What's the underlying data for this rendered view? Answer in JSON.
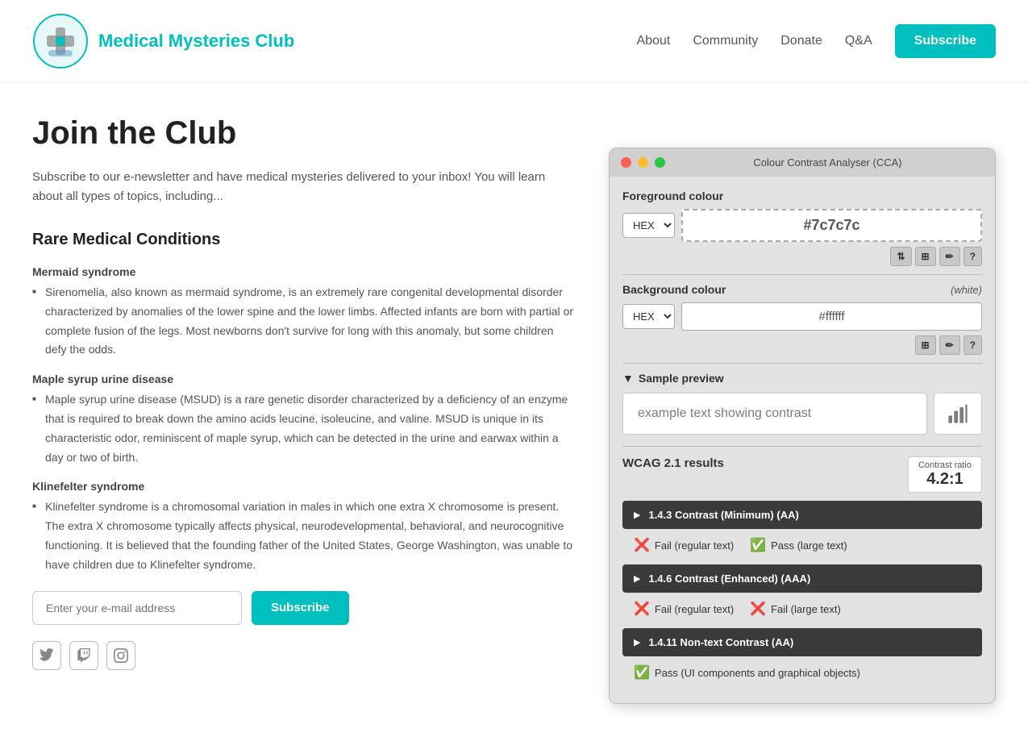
{
  "header": {
    "logo_alt": "Medical Mysteries Club Logo",
    "title": "Medical Mysteries Club",
    "nav": {
      "about": "About",
      "community": "Community",
      "donate": "Donate",
      "qa": "Q&A",
      "subscribe": "Subscribe"
    }
  },
  "main": {
    "page_title": "Join the Club",
    "intro": "Subscribe to our e-newsletter and have medical mysteries delivered to your inbox! You will learn about all types of topics, including...",
    "section_heading": "Rare Medical Conditions",
    "conditions": [
      {
        "title": "Mermaid syndrome",
        "description": "Sirenomelia, also known as mermaid syndrome, is an extremely rare congenital developmental disorder characterized by anomalies of the lower spine and the lower limbs. Affected infants are born with partial or complete fusion of the legs. Most newborns don't survive for long with this anomaly, but some children defy the odds."
      },
      {
        "title": "Maple syrup urine disease",
        "description": "Maple syrup urine disease (MSUD) is a rare genetic disorder characterized by a deficiency of an enzyme that is required to break down the amino acids leucine, isoleucine, and valine. MSUD is unique in its characteristic odor, reminiscent of maple syrup, which can be detected in the urine and earwax within a day or two of birth."
      },
      {
        "title": "Klinefelter syndrome",
        "description": "Klinefelter syndrome is a chromosomal variation in males in which one extra X chromosome is present. The extra X chromosome typically affects physical, neurodevelopmental, behavioral, and neurocognitive functioning. It is believed that the founding father of the United States, George Washington, was unable to have children due to Klinefelter syndrome."
      }
    ],
    "email_placeholder": "Enter your e-mail address",
    "subscribe_btn": "Subscribe"
  },
  "cca": {
    "title": "Colour Contrast Analyser (CCA)",
    "foreground_label": "Foreground colour",
    "foreground_format": "HEX",
    "foreground_value": "#7c7c7c",
    "background_label": "Background colour",
    "background_white": "(white)",
    "background_format": "HEX",
    "background_value": "#ffffff",
    "sample_preview_label": "Sample preview",
    "sample_text": "example text showing contrast",
    "wcag_label": "WCAG 2.1 results",
    "contrast_ratio_label": "Contrast ratio",
    "contrast_ratio_value": "4.2:1",
    "results": [
      {
        "id": "1.4.3 Contrast (Minimum) (AA)",
        "pass_regular": false,
        "pass_large": true,
        "regular_label": "Fail (regular text)",
        "large_label": "Pass (large text)"
      },
      {
        "id": "1.4.6 Contrast (Enhanced) (AAA)",
        "pass_regular": false,
        "pass_large": false,
        "regular_label": "Fail (regular text)",
        "large_label": "Fail (large text)"
      },
      {
        "id": "1.4.11 Non-text Contrast (AA)",
        "pass_nontext": true,
        "nontext_label": "Pass (UI components and graphical objects)"
      }
    ]
  }
}
